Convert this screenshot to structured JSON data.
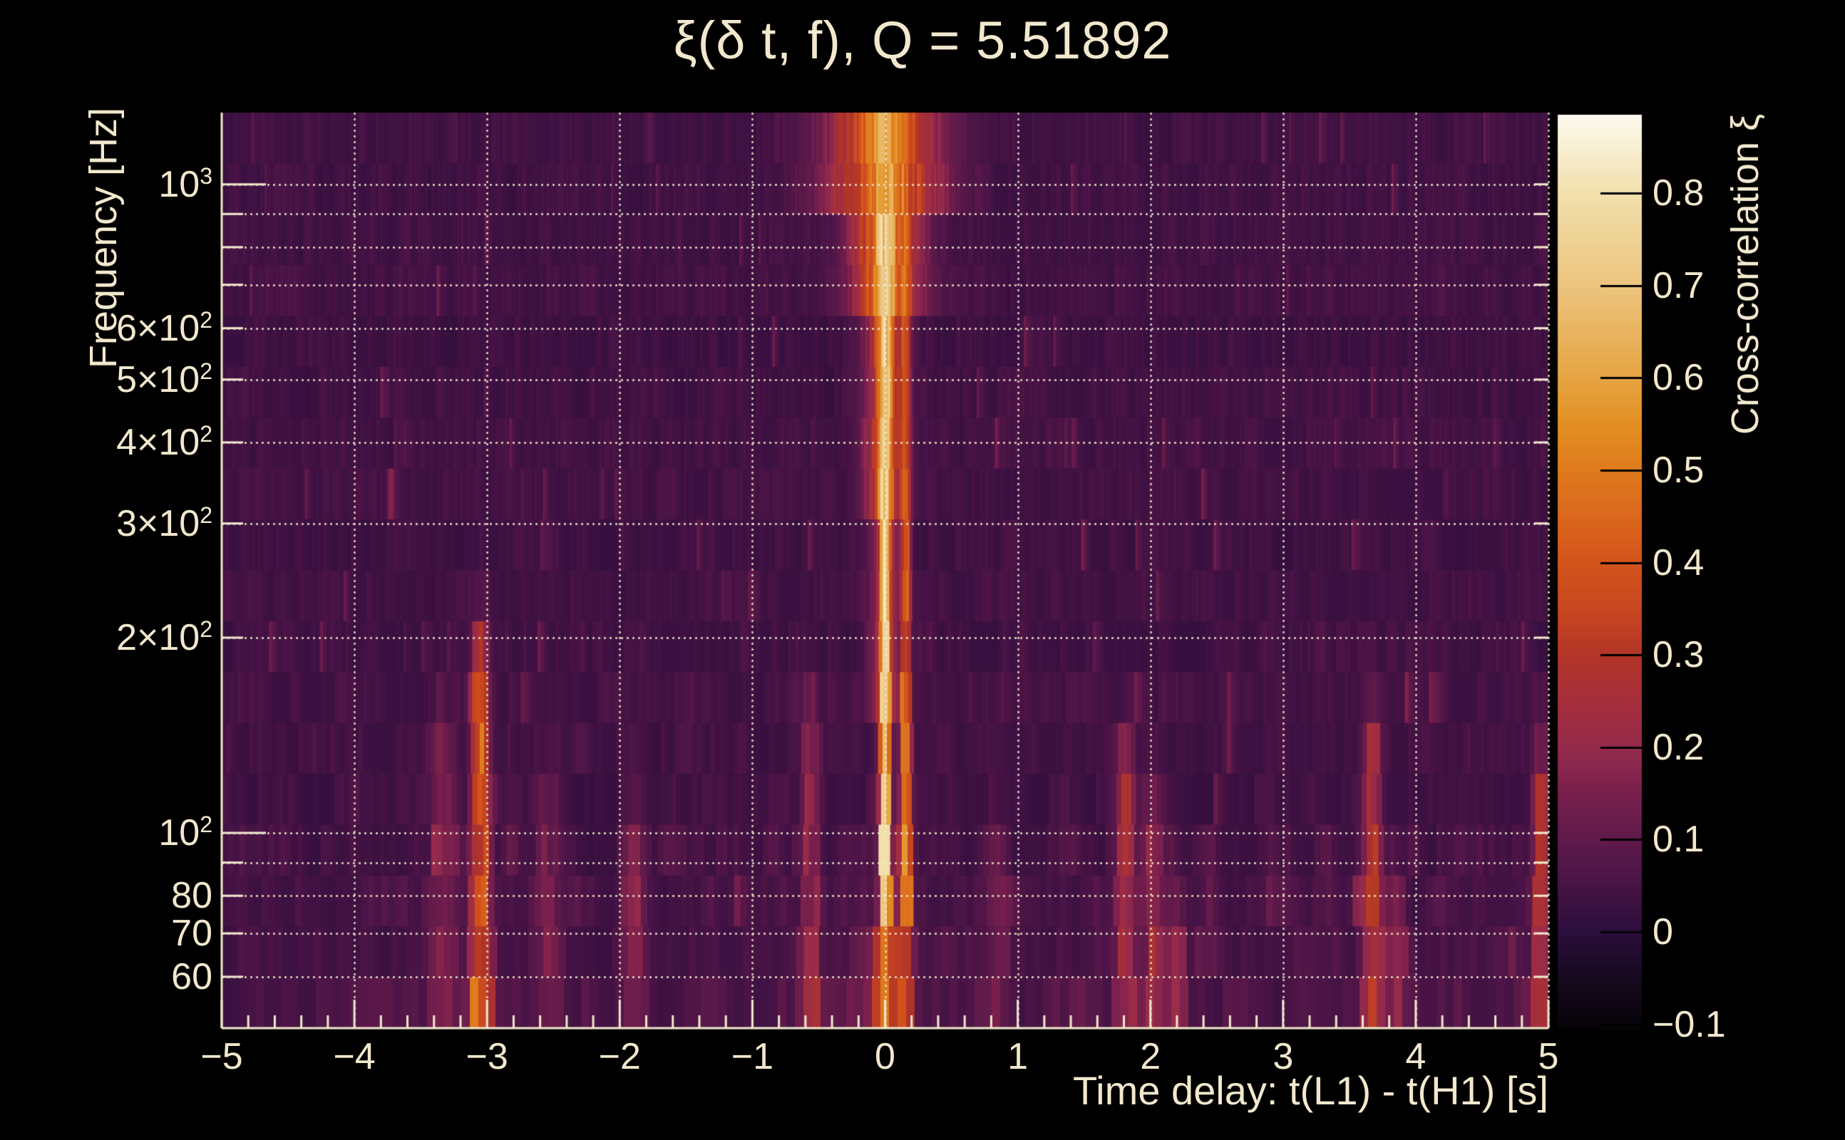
{
  "figure": {
    "background": "#000000",
    "text_color": "#f2e8cd",
    "grid_color": "#f2e8cd"
  },
  "chart_data": {
    "type": "heatmap",
    "title": "ξ(δ t, f), Q = 5.51892",
    "q_value": 5.51892,
    "xlabel": "Time delay: t(L1) - t(H1) [s]",
    "ylabel": "Frequency [Hz]",
    "colorbar_label": "Cross-correlation ξ",
    "x_range": [
      -5,
      5
    ],
    "x_minor_tick_step": 0.2,
    "x_ticks": [
      {
        "label": "−5",
        "value": -5
      },
      {
        "label": "−4",
        "value": -4
      },
      {
        "label": "−3",
        "value": -3
      },
      {
        "label": "−2",
        "value": -2
      },
      {
        "label": "−1",
        "value": -1
      },
      {
        "label": "0",
        "value": 0
      },
      {
        "label": "1",
        "value": 1
      },
      {
        "label": "2",
        "value": 2
      },
      {
        "label": "3",
        "value": 3
      },
      {
        "label": "4",
        "value": 4
      },
      {
        "label": "5",
        "value": 5
      }
    ],
    "x_gridline_values": [
      -4,
      -3,
      -2,
      -1,
      0,
      1,
      2,
      3,
      4,
      5
    ],
    "y_scale": "log",
    "y_range_hz": [
      50,
      1290
    ],
    "y_ticks": [
      {
        "text": "10",
        "sup": "3",
        "value": 1000
      },
      {
        "text": "6×10",
        "sup": "2",
        "value": 600
      },
      {
        "text": "5×10",
        "sup": "2",
        "value": 500
      },
      {
        "text": "4×10",
        "sup": "2",
        "value": 400
      },
      {
        "text": "3×10",
        "sup": "2",
        "value": 300
      },
      {
        "text": "2×10",
        "sup": "2",
        "value": 200
      },
      {
        "text": "10",
        "sup": "2",
        "value": 100
      },
      {
        "text": "80",
        "sup": "",
        "value": 80
      },
      {
        "text": "70",
        "sup": "",
        "value": 70
      },
      {
        "text": "60",
        "sup": "",
        "value": 60
      }
    ],
    "y_gridline_values": [
      1000,
      900,
      800,
      700,
      600,
      500,
      400,
      300,
      200,
      100,
      90,
      80,
      70,
      60
    ],
    "y_major_tick_values": [
      1000,
      100
    ],
    "grid_style": "dotted",
    "colorbar": {
      "min": -0.105,
      "max": 0.885,
      "ticks": [
        {
          "label": "0.8",
          "value": 0.8
        },
        {
          "label": "0.7",
          "value": 0.7
        },
        {
          "label": "0.6",
          "value": 0.6
        },
        {
          "label": "0.5",
          "value": 0.5
        },
        {
          "label": "0.4",
          "value": 0.4
        },
        {
          "label": "0.3",
          "value": 0.3
        },
        {
          "label": "0.2",
          "value": 0.2
        },
        {
          "label": "0.1",
          "value": 0.1
        },
        {
          "label": "0",
          "value": 0
        },
        {
          "label": "−0.1",
          "value": -0.1
        }
      ]
    },
    "colormap_stops": [
      {
        "v": -0.105,
        "color": "#060308"
      },
      {
        "v": -0.05,
        "color": "#16091e"
      },
      {
        "v": 0.0,
        "color": "#2b0e3c"
      },
      {
        "v": 0.05,
        "color": "#471345"
      },
      {
        "v": 0.1,
        "color": "#5f1a4b"
      },
      {
        "v": 0.15,
        "color": "#781f4c"
      },
      {
        "v": 0.2,
        "color": "#952b4c"
      },
      {
        "v": 0.25,
        "color": "#a52e3c"
      },
      {
        "v": 0.3,
        "color": "#b23527"
      },
      {
        "v": 0.35,
        "color": "#c84720"
      },
      {
        "v": 0.4,
        "color": "#d4541c"
      },
      {
        "v": 0.5,
        "color": "#df7a1d"
      },
      {
        "v": 0.55,
        "color": "#e28f22"
      },
      {
        "v": 0.6,
        "color": "#e6a443"
      },
      {
        "v": 0.7,
        "color": "#ecc47e"
      },
      {
        "v": 0.8,
        "color": "#f2e0ac"
      },
      {
        "v": 0.885,
        "color": "#fcf9ee"
      }
    ],
    "heatmap_model": {
      "rows": 18,
      "background_noise": {
        "base": 0.02,
        "amp": 0.055,
        "spike_prob": 0.013,
        "spike_amp": 0.12,
        "band_boosts": [
          {
            "f_max": 65,
            "factor": 2.0
          },
          {
            "f_max": 110,
            "factor": 1.55
          },
          {
            "f_max": 220,
            "factor": 1.25
          }
        ]
      },
      "main_ridge_t": 0.0,
      "echo_ridge_t": 0.155,
      "echo_sigma": 0.02,
      "ridge_bands": [
        {
          "f_lo": 900,
          "f_hi": 1290,
          "wide_amp": 0.38,
          "wide_sigma": 0.3,
          "core_amp": 0.18,
          "core_sigma": 0.07,
          "echo_amp": 0.05
        },
        {
          "f_lo": 600,
          "f_hi": 900,
          "wide_amp": 0.4,
          "wide_sigma": 0.18,
          "core_amp": 0.28,
          "core_sigma": 0.05,
          "echo_amp": 0.12
        },
        {
          "f_lo": 300,
          "f_hi": 600,
          "wide_amp": 0.28,
          "wide_sigma": 0.11,
          "core_amp": 0.42,
          "core_sigma": 0.03,
          "echo_amp": 0.24
        },
        {
          "f_lo": 150,
          "f_hi": 300,
          "wide_amp": 0.2,
          "wide_sigma": 0.075,
          "core_amp": 0.5,
          "core_sigma": 0.02,
          "echo_amp": 0.32
        },
        {
          "f_lo": 70,
          "f_hi": 150,
          "wide_amp": 0.14,
          "wide_sigma": 0.05,
          "core_amp": 0.55,
          "core_sigma": 0.015,
          "echo_amp": 0.4
        },
        {
          "f_lo": 50,
          "f_hi": 70,
          "wide_amp": 0.16,
          "wide_sigma": 0.13,
          "core_amp": 0.26,
          "core_sigma": 0.025,
          "echo_amp": 0.2
        }
      ],
      "secondary_stripes": [
        {
          "t": -3.05,
          "amp": 0.34,
          "sigma": 0.04,
          "f_lo": 52,
          "f_hi": 165
        },
        {
          "t": -3.32,
          "amp": 0.12,
          "sigma": 0.06,
          "f_lo": 52,
          "f_hi": 120
        },
        {
          "t": -2.55,
          "amp": 0.09,
          "sigma": 0.05,
          "f_lo": 52,
          "f_hi": 100
        },
        {
          "t": -1.9,
          "amp": 0.1,
          "sigma": 0.05,
          "f_lo": 52,
          "f_hi": 95
        },
        {
          "t": -0.56,
          "amp": 0.15,
          "sigma": 0.035,
          "f_lo": 55,
          "f_hi": 135
        },
        {
          "t": 0.85,
          "amp": 0.08,
          "sigma": 0.05,
          "f_lo": 52,
          "f_hi": 90
        },
        {
          "t": 1.81,
          "amp": 0.19,
          "sigma": 0.035,
          "f_lo": 55,
          "f_hi": 115
        },
        {
          "t": 2.02,
          "amp": 0.11,
          "sigma": 0.06,
          "f_lo": 52,
          "f_hi": 100
        },
        {
          "t": 2.2,
          "amp": 0.13,
          "sigma": 0.035,
          "f_lo": 50,
          "f_hi": 64
        },
        {
          "t": 3.67,
          "amp": 0.22,
          "sigma": 0.04,
          "f_lo": 55,
          "f_hi": 125
        },
        {
          "t": 3.85,
          "amp": 0.12,
          "sigma": 0.04,
          "f_lo": 50,
          "f_hi": 70
        },
        {
          "t": 4.95,
          "amp": 0.21,
          "sigma": 0.035,
          "f_lo": 58,
          "f_hi": 112
        }
      ]
    }
  }
}
